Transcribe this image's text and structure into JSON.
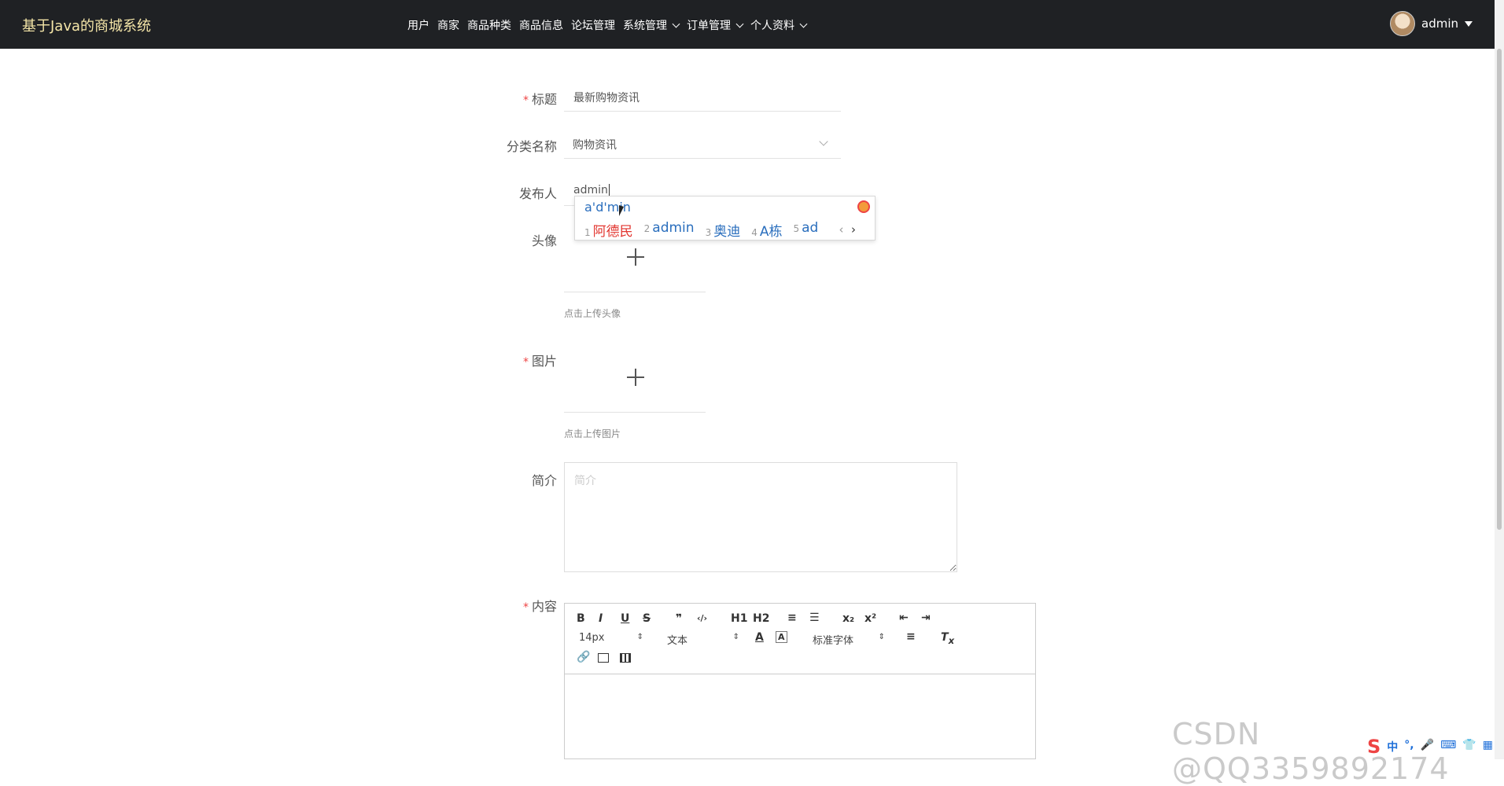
{
  "header": {
    "brand": "基于Java的商城系统",
    "nav": [
      "用户",
      "商家",
      "商品种类",
      "商品信息",
      "论坛管理",
      "系统管理",
      "订单管理",
      "个人资料"
    ],
    "username": "admin"
  },
  "form": {
    "title_label": "标题",
    "title_value": "最新购物资讯",
    "category_label": "分类名称",
    "category_value": "购物资讯",
    "publisher_label": "发布人",
    "publisher_value": "admin",
    "avatar_label": "头像",
    "avatar_hint": "点击上传头像",
    "image_label": "图片",
    "image_hint": "点击上传图片",
    "desc_label": "简介",
    "desc_placeholder": "简介",
    "content_label": "内容",
    "required_mark": "*"
  },
  "ime": {
    "pinyin": "a'd'min",
    "candidates": [
      {
        "n": "1",
        "text": "阿德民"
      },
      {
        "n": "2",
        "text": "admin"
      },
      {
        "n": "3",
        "text": "奥迪"
      },
      {
        "n": "4",
        "text": "A栋"
      },
      {
        "n": "5",
        "text": "ad"
      }
    ],
    "prev": "‹",
    "next": "›"
  },
  "editor": {
    "font_size": "14px",
    "header_select": "文本",
    "font_family": "标准字体",
    "buttons": [
      "B",
      "I",
      "U",
      "S",
      "❞",
      "‹/›",
      "H1",
      "H2",
      "≡",
      "☰",
      "x₂",
      "x²",
      "⇤",
      "⇥"
    ]
  },
  "watermark": "CSDN @QQ3359892174",
  "tray": [
    "中",
    "°,",
    "🎤",
    "⌨",
    "👕",
    "▦"
  ]
}
